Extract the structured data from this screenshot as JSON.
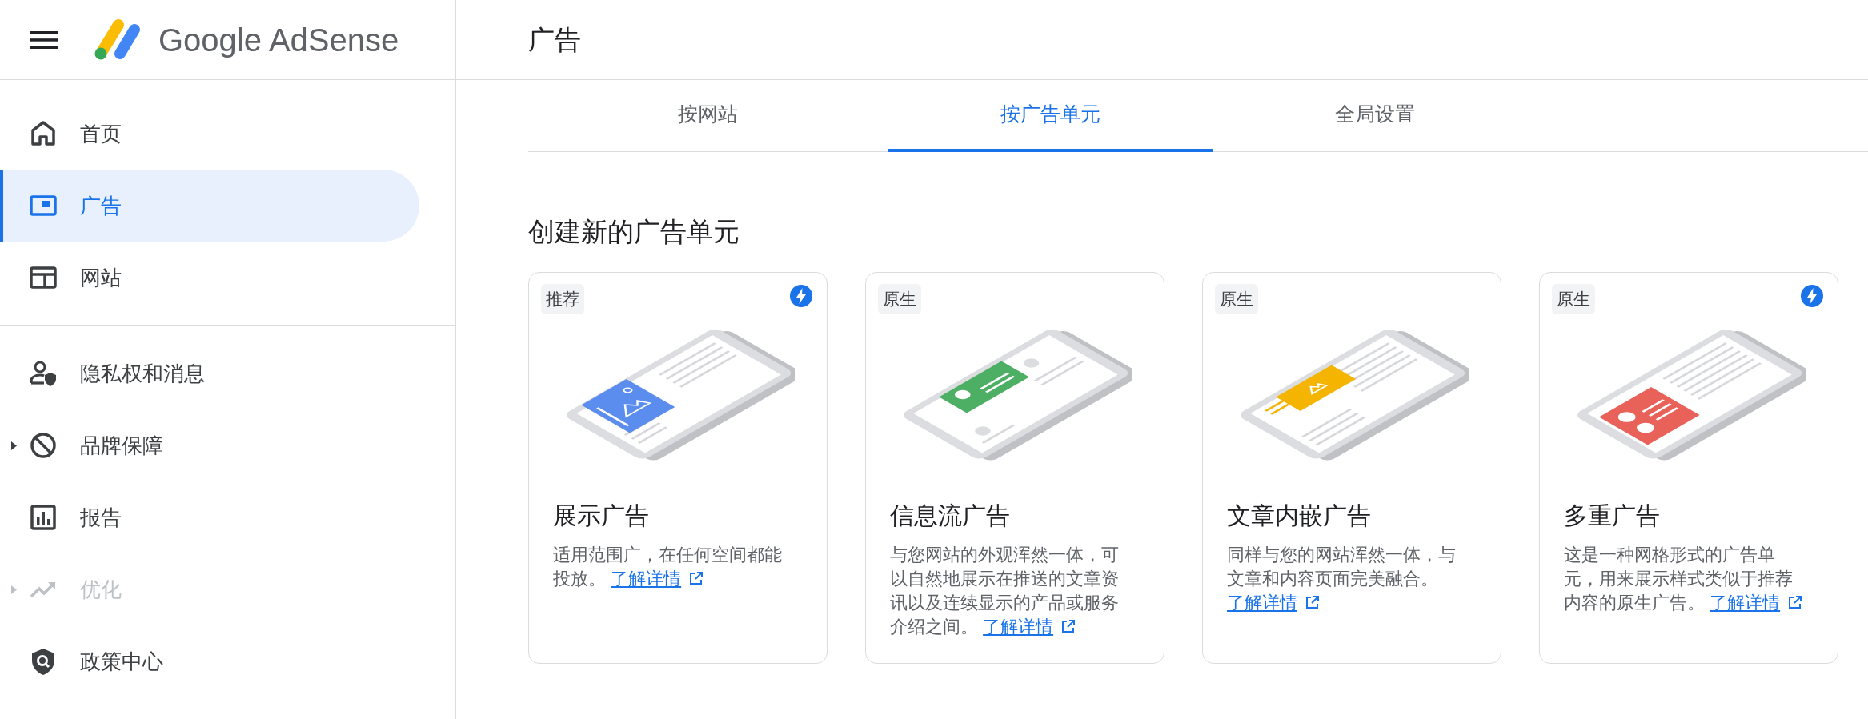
{
  "header": {
    "product_name": "Google AdSense",
    "page_title": "广告"
  },
  "sidebar": {
    "sections": [
      {
        "items": [
          {
            "label": "首页",
            "selected": false,
            "disabled": false,
            "expandable": false
          },
          {
            "label": "广告",
            "selected": true,
            "disabled": false,
            "expandable": false
          },
          {
            "label": "网站",
            "selected": false,
            "disabled": false,
            "expandable": false
          }
        ]
      },
      {
        "items": [
          {
            "label": "隐私权和消息",
            "selected": false,
            "disabled": false,
            "expandable": false
          },
          {
            "label": "品牌保障",
            "selected": false,
            "disabled": false,
            "expandable": true
          },
          {
            "label": "报告",
            "selected": false,
            "disabled": false,
            "expandable": false
          },
          {
            "label": "优化",
            "selected": false,
            "disabled": true,
            "expandable": true
          },
          {
            "label": "政策中心",
            "selected": false,
            "disabled": false,
            "expandable": false
          }
        ]
      }
    ]
  },
  "tabs": [
    {
      "label": "按网站",
      "selected": false
    },
    {
      "label": "按广告单元",
      "selected": true
    },
    {
      "label": "全局设置",
      "selected": false
    }
  ],
  "section_heading": "创建新的广告单元",
  "cards": [
    {
      "kind": "display",
      "tag": "推荐",
      "boosted": true,
      "title": "展示广告",
      "description": "适用范围广，在任何空间都能投放。",
      "link": "了解详情"
    },
    {
      "kind": "feed",
      "tag": "原生",
      "boosted": false,
      "title": "信息流广告",
      "description": "与您网站的外观浑然一体，可以自然地展示在推送的文章资讯以及连续显示的产品或服务介绍之间。",
      "link": "了解详情"
    },
    {
      "kind": "in_article",
      "tag": "原生",
      "boosted": false,
      "title": "文章内嵌广告",
      "description": "同样与您的网站浑然一体，与文章和内容页面完美融合。",
      "link": "了解详情"
    },
    {
      "kind": "multiplex",
      "tag": "原生",
      "boosted": true,
      "title": "多重广告",
      "description": "这是一种网格形式的广告单元，用来展示样式类似于推荐内容的原生广告。",
      "link": "了解详情"
    }
  ]
}
